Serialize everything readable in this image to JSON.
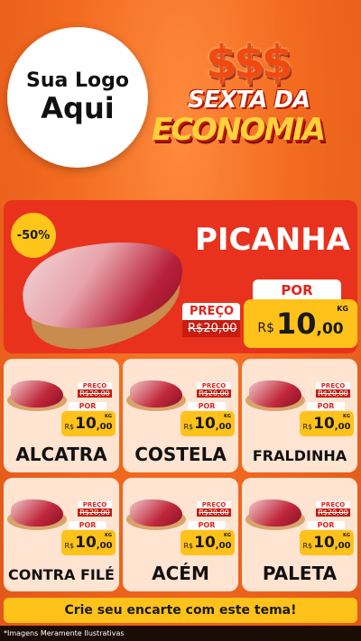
{
  "logo": {
    "line1": "Sua Logo",
    "line2": "Aqui"
  },
  "header": {
    "dollars": "$$$",
    "line1": "SEXTA DA",
    "line2": "ECONOMIA"
  },
  "hero": {
    "discount": "-50%",
    "name": "PICANHA",
    "preco_label": "PREÇO",
    "old_price": "R$20,00",
    "por_label": "POR",
    "currency": "R$",
    "price_int": "10",
    "price_cents": ",00",
    "unit": "KG"
  },
  "products": [
    {
      "name": "ALCATRA",
      "preco_label": "PREÇO",
      "old_price": "R$20,00",
      "por_label": "POR",
      "currency": "R$",
      "price_int": "10",
      "price_cents": ",00",
      "unit": "KG"
    },
    {
      "name": "COSTELA",
      "preco_label": "PREÇO",
      "old_price": "R$20,00",
      "por_label": "POR",
      "currency": "R$",
      "price_int": "10",
      "price_cents": ",00",
      "unit": "KG"
    },
    {
      "name": "FRALDINHA",
      "preco_label": "PREÇO",
      "old_price": "R$20,00",
      "por_label": "POR",
      "currency": "R$",
      "price_int": "10",
      "price_cents": ",00",
      "unit": "KG"
    },
    {
      "name": "CONTRA FILÉ",
      "preco_label": "PREÇO",
      "old_price": "R$20,00",
      "por_label": "POR",
      "currency": "R$",
      "price_int": "10",
      "price_cents": ",00",
      "unit": "KG"
    },
    {
      "name": "ACÉM",
      "preco_label": "PREÇO",
      "old_price": "R$20,00",
      "por_label": "POR",
      "currency": "R$",
      "price_int": "10",
      "price_cents": ",00",
      "unit": "KG"
    },
    {
      "name": "PALETA",
      "preco_label": "PREÇO",
      "old_price": "R$20,00",
      "por_label": "POR",
      "currency": "R$",
      "price_int": "10",
      "price_cents": ",00",
      "unit": "KG"
    }
  ],
  "cta": "Crie seu encarte com este tema!",
  "footer": "*Imagens Meramente Ilustrativas",
  "colors": {
    "background": "#f26b1f",
    "hero": "#e8321e",
    "price": "#ffc21a",
    "card": "#ffe4d2"
  }
}
